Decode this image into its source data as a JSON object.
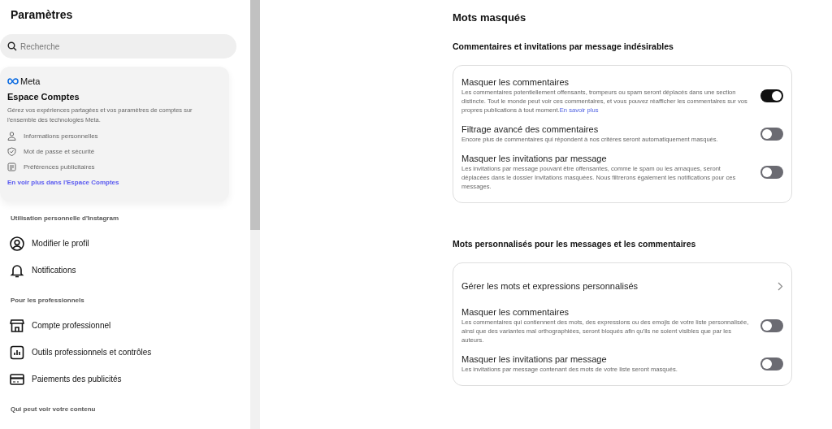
{
  "sidebar": {
    "title": "Paramètres",
    "search": {
      "placeholder": "Recherche"
    },
    "accounts_card": {
      "brand": "Meta",
      "title": "Espace Comptes",
      "description": "Gérez vos expériences partagées et vos paramètres de comptes sur l'ensemble des technologies Meta.",
      "items": [
        {
          "kind": "person",
          "label": "Informations personnelles"
        },
        {
          "kind": "shield",
          "label": "Mot de passe et sécurité"
        },
        {
          "kind": "ad",
          "label": "Préférences publicitaires"
        }
      ],
      "link": "En voir plus dans l'Espace Comptes"
    },
    "sections": [
      {
        "heading": "Utilisation personnelle d'Instagram",
        "items": [
          {
            "kind": "profile",
            "label": "Modifier le profil"
          },
          {
            "kind": "bell",
            "label": "Notifications"
          }
        ]
      },
      {
        "heading": "Pour les professionnels",
        "items": [
          {
            "kind": "shop",
            "label": "Compte professionnel"
          },
          {
            "kind": "chart",
            "label": "Outils professionnels et contrôles"
          },
          {
            "kind": "card",
            "label": "Paiements des publicités"
          }
        ]
      },
      {
        "heading": "Qui peut voir votre contenu"
      }
    ]
  },
  "main": {
    "title": "Mots masqués",
    "groups": [
      {
        "heading": "Commentaires et invitations par message indésirables",
        "rows": [
          {
            "kind": "toggle",
            "title": "Masquer les commentaires",
            "description": "Les commentaires potentiellement offensants, trompeurs ou spam seront déplacés dans une section distincte. Tout le monde peut voir ces commentaires, et vous pouvez réafficher les commentaires sur vos propres publications à tout moment.",
            "link": "En savoir plus",
            "on": true
          },
          {
            "kind": "toggle",
            "title": "Filtrage avancé des commentaires",
            "description": "Encore plus de commentaires qui répondent à nos critères seront automatiquement masqués.",
            "on": false
          },
          {
            "kind": "toggle",
            "title": "Masquer les invitations par message",
            "description": "Les invitations par message pouvant être offensantes, comme le spam ou les arnaques, seront déplacées dans le dossier Invitations masquées. Nous filtrerons également les notifications pour ces messages.",
            "on": false
          }
        ]
      },
      {
        "heading": "Mots personnalisés pour les messages et les commentaires",
        "rows": [
          {
            "kind": "link",
            "title": "Gérer les mots et expressions personnalisés"
          },
          {
            "kind": "toggle",
            "title": "Masquer les commentaires",
            "description": "Les commentaires qui contiennent des mots, des expressions ou des emojis de votre liste personnalisée, ainsi que des variantes mal orthographiées, seront bloqués afin qu'ils ne soient visibles que par les auteurs.",
            "on": false
          },
          {
            "kind": "toggle",
            "title": "Masquer les invitations par message",
            "description": "Les invitations par message contenant des mots de votre liste seront masqués.",
            "on": false
          }
        ]
      }
    ]
  }
}
